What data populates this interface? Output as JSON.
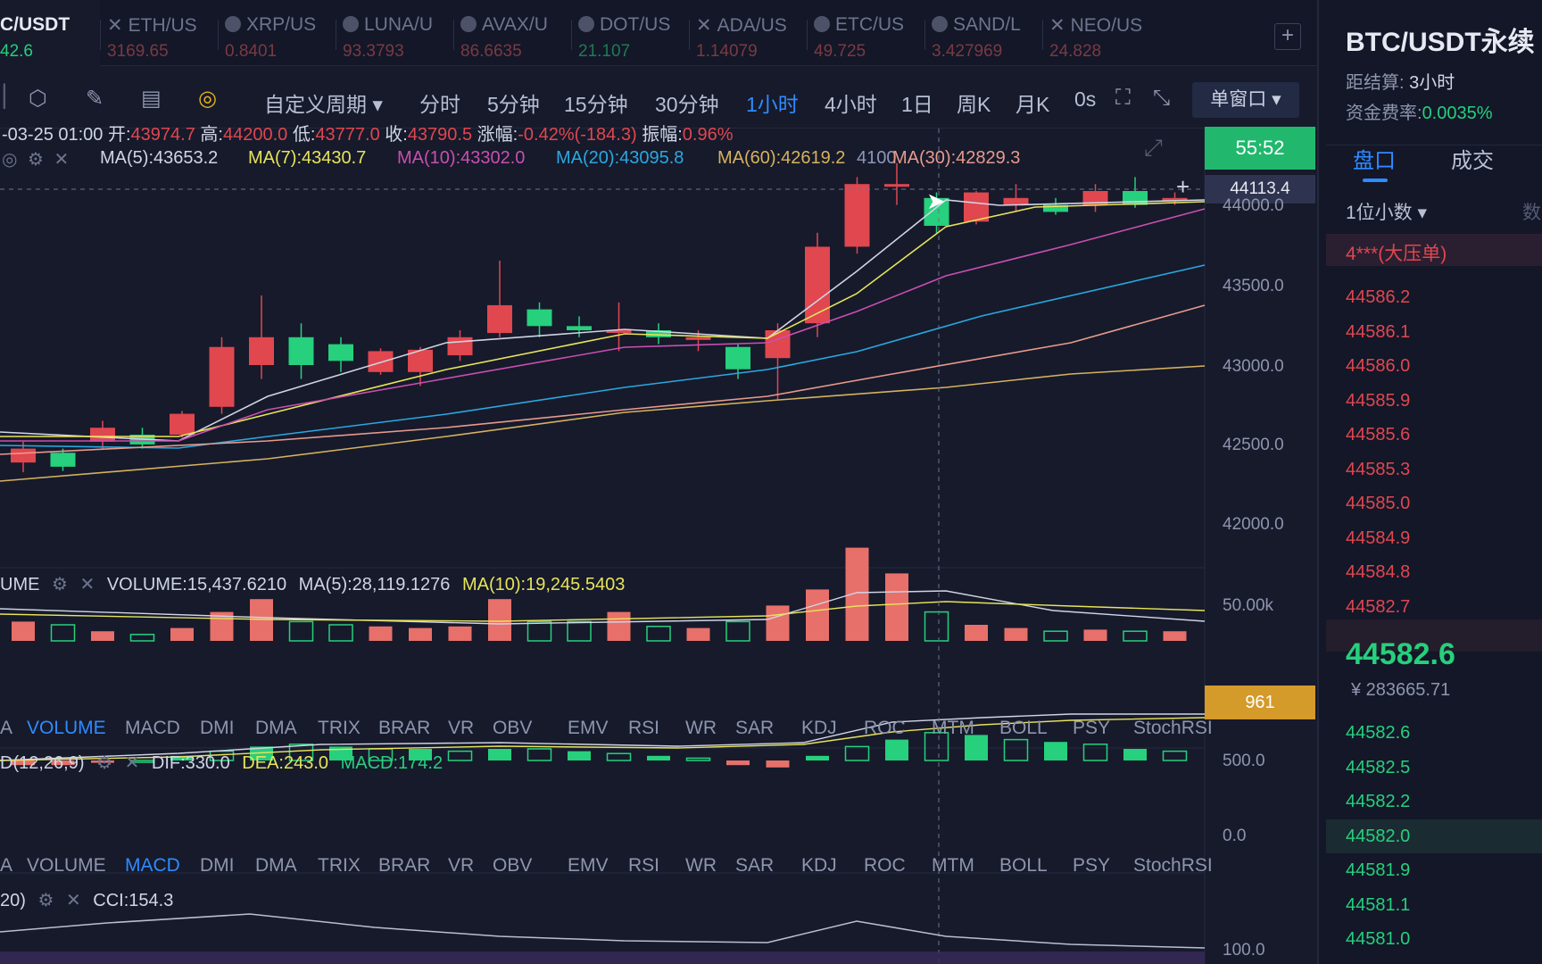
{
  "ticker_tabs": [
    {
      "name": "C/USDT",
      "price": "42.6",
      "active": true,
      "icon": "coin-icon"
    },
    {
      "name": "ETH/US",
      "price": "3169.65",
      "up": false,
      "icon": "close-icon"
    },
    {
      "name": "XRP/US",
      "price": "0.8401",
      "up": false,
      "icon": "coin-icon"
    },
    {
      "name": "LUNA/U",
      "price": "93.3793",
      "up": false,
      "icon": "coin-icon"
    },
    {
      "name": "AVAX/U",
      "price": "86.6635",
      "up": false,
      "icon": "coin-icon"
    },
    {
      "name": "DOT/US",
      "price": "21.107",
      "up": true,
      "icon": "coin-icon"
    },
    {
      "name": "ADA/US",
      "price": "1.14079",
      "up": false,
      "icon": "close-icon"
    },
    {
      "name": "ETC/US",
      "price": "49.725",
      "up": false,
      "icon": "coin-icon"
    },
    {
      "name": "SAND/L",
      "price": "3.427969",
      "up": false,
      "icon": "coin-icon"
    },
    {
      "name": "NEO/US",
      "price": "24.828",
      "up": false,
      "icon": "close-icon"
    }
  ],
  "add_tab": "+",
  "toolbar": {
    "custom_period": "自定义周期 ▾",
    "periods": [
      "分时",
      "5分钟",
      "15分钟",
      "30分钟",
      "1小时",
      "4小时",
      "1日",
      "周K",
      "月K",
      "0s"
    ],
    "active_period": "1小时",
    "window_mode": "单窗口 ▾"
  },
  "ohlc_line": {
    "date": "-03-25 01:00",
    "open_label": "开:",
    "open": "43974.7",
    "high_label": "高:",
    "high": "44200.0",
    "low_label": "低:",
    "low": "43777.0",
    "close_label": "收:",
    "close": "43790.5",
    "change_label": "涨幅:",
    "change": "-0.42%(-184.3)",
    "amp_label": "振幅:",
    "amp": "0.96%"
  },
  "ma_line": {
    "ma5": "MA(5):43653.2",
    "ma7": "MA(7):43430.7",
    "ma10": "MA(10):43302.0",
    "ma20": "MA(20):43095.8",
    "ma60": "MA(60):42619.2",
    "ma30": "MA(30):42829.3",
    "ma30_overlap": "4100"
  },
  "countdown": "55:52",
  "crosshair_price": "44113.4",
  "price_axis": [
    "44000.0",
    "43500.0",
    "43000.0",
    "42500.0",
    "42000.0"
  ],
  "volume_header": {
    "name": "UME",
    "volume": "VOLUME:15,437.6210",
    "ma5": "MA(5):28,119.1276",
    "ma10": "MA(10):19,245.5403"
  },
  "volume_axis": "50.00k",
  "volume_marker": "961",
  "indicator_tabs": [
    "A",
    "VOLUME",
    "MACD",
    "DMI",
    "DMA",
    "TRIX",
    "BRAR",
    "VR",
    "OBV",
    "EMV",
    "RSI",
    "WR",
    "SAR",
    "KDJ",
    "ROC",
    "MTM",
    "BOLL",
    "PSY",
    "StochRSI"
  ],
  "macd_header": {
    "name": "D(12,26,9)",
    "dif": "DIF:330.0",
    "dea": "DEA:243.0",
    "macd": "MACD:174.2"
  },
  "macd_axis": [
    "500.0",
    "0.0"
  ],
  "cci_header": {
    "name": "20)",
    "cci": "CCI:154.3"
  },
  "cci_axis": "100.0",
  "right_panel": {
    "title": "BTC/USDT永续",
    "settle_label": "距结算",
    "settle_value": "3小时",
    "funding_label": "资金费率",
    "funding_value": "0.0035%",
    "tab_book": "盘口",
    "tab_trades": "成交",
    "decimals": "1位小数 ▾",
    "decimals_extra": "数",
    "big_order": "4***(大压单)",
    "asks": [
      "44586.2",
      "44586.1",
      "44586.0",
      "44585.9",
      "44585.6",
      "44585.3",
      "44585.0",
      "44584.9",
      "44584.8",
      "44582.7"
    ],
    "last_price": "44582.6",
    "last_price_cny": "¥ 283665.71",
    "bids": [
      "44582.6",
      "44582.5",
      "44582.2",
      "44582.0",
      "44581.9",
      "44581.1",
      "44581.0"
    ]
  },
  "colors": {
    "up": "#e0474f",
    "down": "#26d07c",
    "accent": "#2f8bff",
    "bg": "#161a2b"
  }
}
